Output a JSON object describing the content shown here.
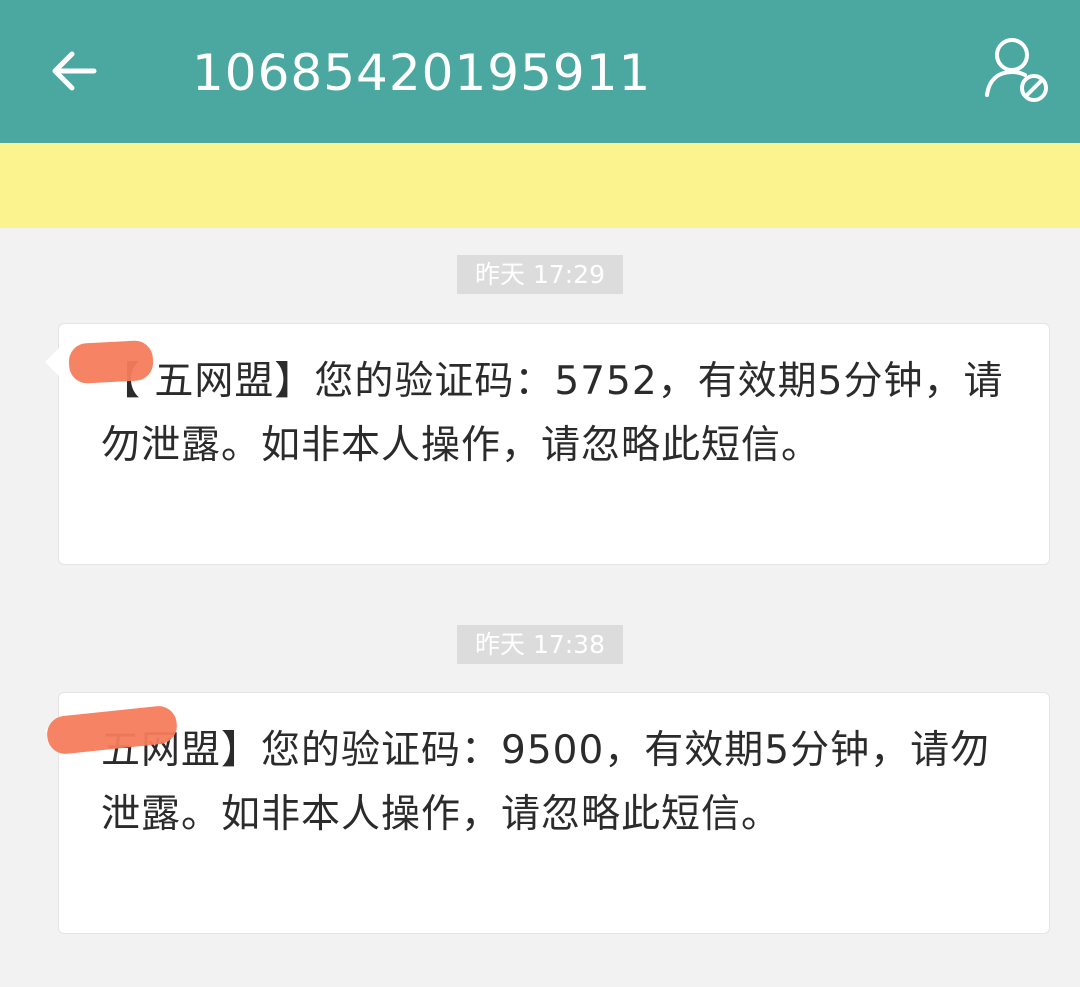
{
  "header": {
    "title": "10685420195911",
    "back_icon": "arrow-left-icon",
    "contact_icon": "contact-block-icon",
    "bg_color": "#4aa8a0"
  },
  "messages": [
    {
      "timestamp": "昨天 17:29",
      "text": "【 五网盟】您的验证码：5752，有效期5分钟，请勿泄露。如非本人操作，请忽略此短信。"
    },
    {
      "timestamp": "昨天 17:38",
      "text": "  五网盟】您的验证码：9500，有效期5分钟，请勿泄露。如非本人操作，请忽略此短信。"
    }
  ],
  "colors": {
    "highlight": "#fbf38e",
    "redaction": "#f67c5c",
    "background": "#f2f2f2"
  }
}
